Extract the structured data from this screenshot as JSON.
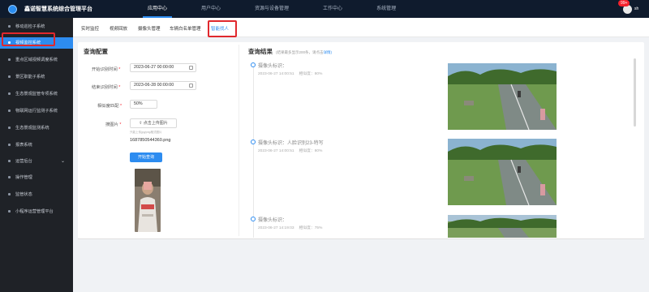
{
  "app": {
    "title": "鑫诺智慧系统综合管理平台",
    "badge": "99+",
    "user": "sh"
  },
  "topnav": [
    "应用中心",
    "用户中心",
    "资源与设备管理",
    "工作中心",
    "系统管理"
  ],
  "sidebar": [
    "移动巡检子系统",
    "视频监控系统",
    "重点区域视频调度系统",
    "景区职能子系统",
    "生态景观监管专项系统",
    "物联网运行监测子系统",
    "生态景观监测系统",
    "报表系统",
    "运营后台",
    "操作管理",
    "监管状态",
    "小程序运营管理平台"
  ],
  "tabs": [
    "实时监控",
    "视频回放",
    "摄像头管理",
    "车辆白名单管理",
    "智能找人"
  ],
  "config": {
    "title": "查询配置",
    "start_label": "开始识别时间",
    "start_value": "2023-06-27 00:00:00",
    "end_label": "结束识别时间",
    "end_value": "2023-06-28 00:00:00",
    "sim_label": "相似度匹配",
    "sim_value": "50%",
    "img_label": "搜图片",
    "upload_label": "点击上传图片",
    "hint": "只能上传jpg/png格式图片",
    "filename": "1687850544360.png",
    "query_label": "开始查询"
  },
  "results": {
    "title": "查询结果",
    "subtitle": "(结果最多显示200条，请点击",
    "subtitle_link": "详情)",
    "items": [
      {
        "label": "摄像头标识：",
        "time": "2023-06-27 14:00:51",
        "similarity": "相似度：80%"
      },
      {
        "label": "摄像头标识：人脸识别23-特写",
        "time": "2023-06-27 14:00:51",
        "similarity": "相似度：80%"
      },
      {
        "label": "摄像头标识：",
        "time": "2023-06-27 14:19:03",
        "similarity": "相似度：75%"
      }
    ]
  },
  "colors": {
    "accent": "#2d8cf0",
    "topbar": "#0f1b2d",
    "sidebar": "#1f2227",
    "highlight": "#e0282d"
  }
}
